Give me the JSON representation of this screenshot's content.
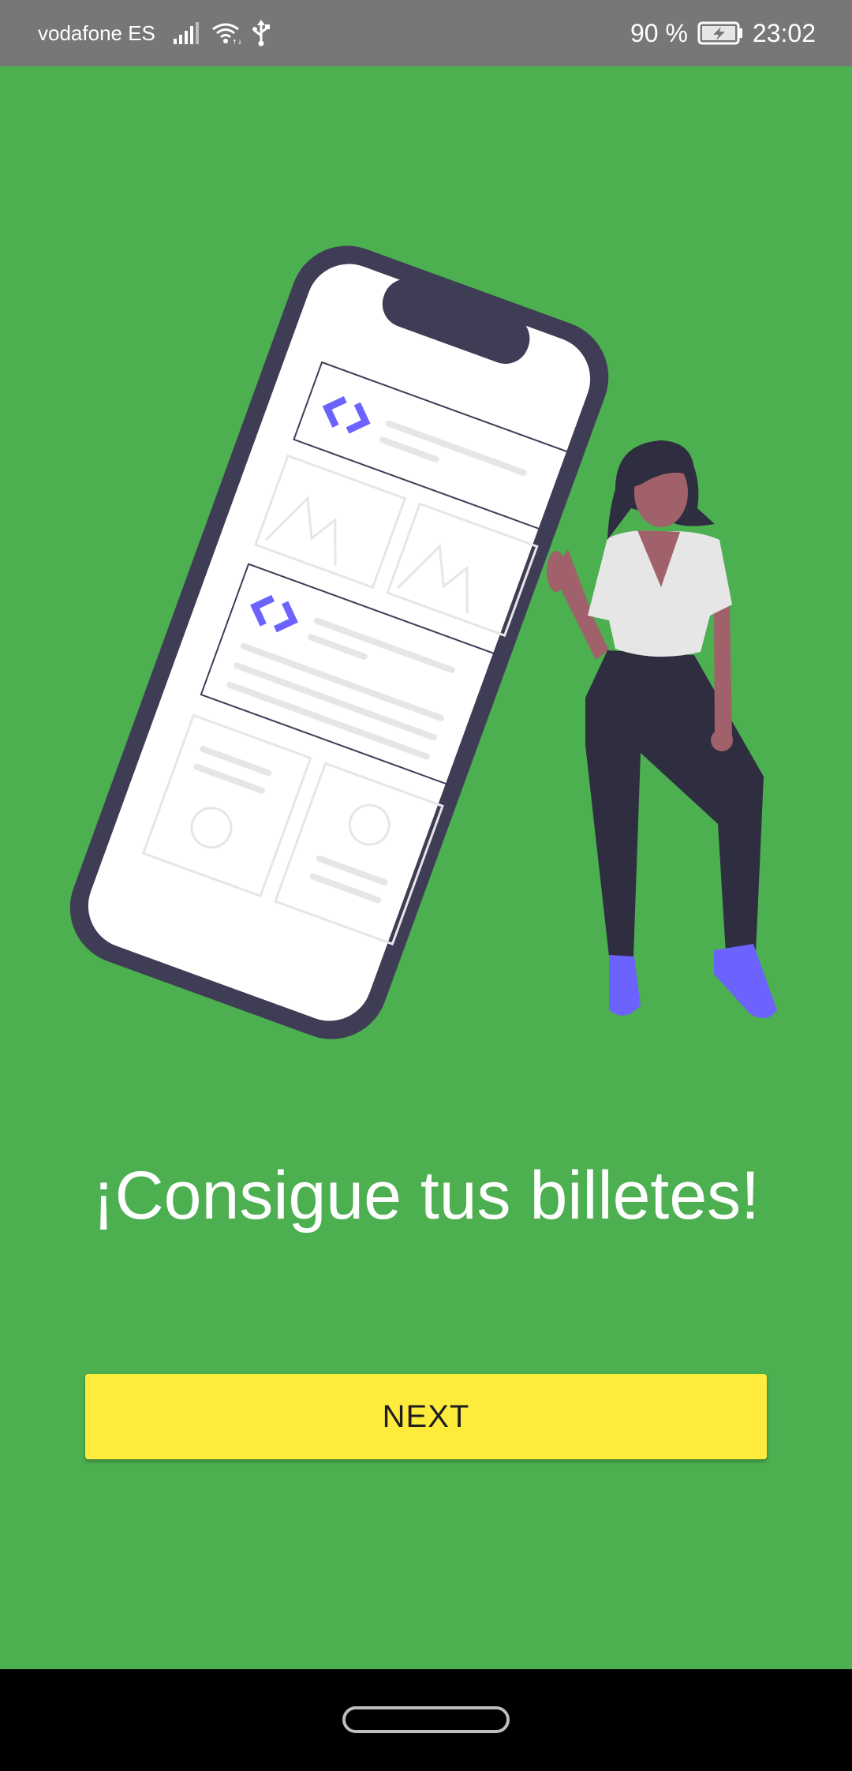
{
  "status_bar": {
    "carrier": "vodafone ES",
    "battery_percent": "90 %",
    "time": "23:02",
    "icons": [
      "signal-icon",
      "wifi-icon",
      "usb-icon",
      "battery-charging-icon"
    ]
  },
  "onboarding": {
    "headline": "¡Consigue tus billetes!",
    "next_label": "NEXT"
  },
  "colors": {
    "background": "#4caf50",
    "button": "#ffeb3b",
    "accent": "#6c63ff",
    "status_bar": "#777777"
  }
}
